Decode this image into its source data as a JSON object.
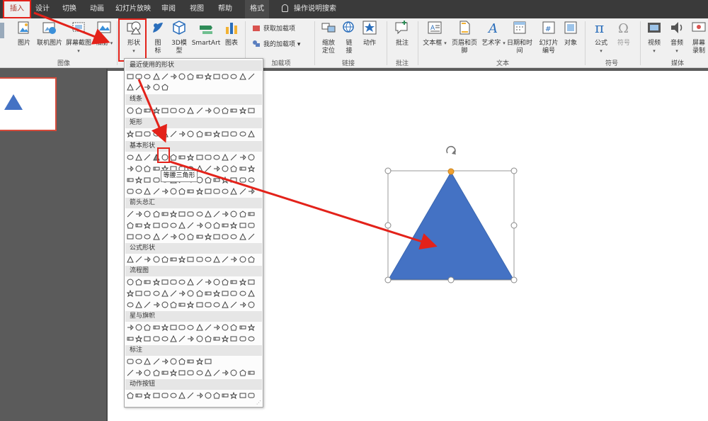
{
  "tabs": [
    "插入",
    "设计",
    "切换",
    "动画",
    "幻灯片放映",
    "审阅",
    "视图",
    "帮助",
    "格式"
  ],
  "search": "操作说明搜索",
  "ribbon": {
    "picture": "图片",
    "online_picture": "联机图片",
    "screenshot": "屏幕截图",
    "album": "相册",
    "shapes": "形状",
    "icons": "图标",
    "model3d": "3D模型",
    "smartart": "SmartArt",
    "chart": "图表",
    "get_addins": "获取加载项",
    "my_addins": "我的加载项",
    "zoom": "缩放定位",
    "link": "链接",
    "action": "动作",
    "comment": "批注",
    "textbox": "文本框",
    "header_footer": "页眉和页脚",
    "wordart": "艺术字",
    "datetime": "日期和时间",
    "slide_number": "幻灯片编号",
    "object": "对象",
    "equation": "公式",
    "symbol": "符号",
    "video": "视频",
    "audio": "音频",
    "screen_record": "屏幕录制"
  },
  "groups": {
    "images": "图像",
    "addins": "加载项",
    "links": "链接",
    "comments": "批注",
    "text": "文本",
    "symbols": "符号",
    "media": "媒体"
  },
  "gallery": {
    "recent": "最近使用的形状",
    "lines": "线条",
    "rectangles": "矩形",
    "basic": "基本形状",
    "arrows": "箭头总汇",
    "equation": "公式形状",
    "flowchart": "流程图",
    "stars": "星与旗帜",
    "callouts": "标注",
    "actions": "动作按钮",
    "tooltip": "等腰三角形"
  },
  "colors": {
    "accent": "#4472c4",
    "highlight": "#e3221a",
    "handle": "#f0a030"
  }
}
